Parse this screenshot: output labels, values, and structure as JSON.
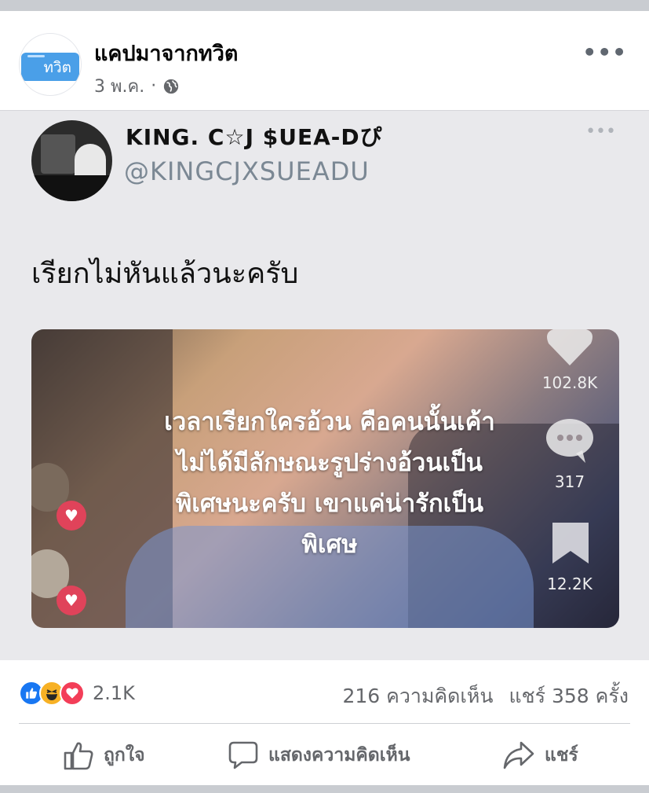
{
  "post": {
    "page_name": "แคปมาจากทวิต",
    "avatar_text": "ทวิต",
    "date": "3 พ.ค.",
    "separator": "·"
  },
  "tweet": {
    "display_name": "KING. C☆J $UEA-Dぴ",
    "handle": "@KINGCJXSUEADU",
    "text": "เรียกไม่หันแล้วนะครับ"
  },
  "video": {
    "caption_lines": [
      "เวลาเรียกใครอ้วน คือคนนั้นเค้า",
      "ไม่ได้มีลักษณะรูปร่างอ้วนเป็น",
      "พิเศษนะครับ เขาแค่น่ารักเป็น",
      "พิเศษ"
    ],
    "likes": "102.8K",
    "comments": "317",
    "saves": "12.2K"
  },
  "stats": {
    "reaction_count": "2.1K",
    "comments": "216 ความคิดเห็น",
    "shares": "แชร์ 358 ครั้ง"
  },
  "actions": {
    "like": "ถูกใจ",
    "comment": "แสดงความคิดเห็น",
    "share": "แชร์"
  },
  "colors": {
    "like_blue": "#1877f2",
    "haha_yellow": "#f7b125",
    "love_red": "#f33e58",
    "muted_text": "#65676b"
  }
}
